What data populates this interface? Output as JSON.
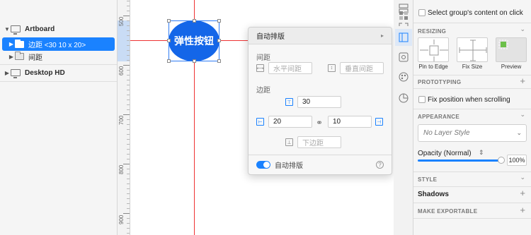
{
  "layers": {
    "artboard": "Artboard",
    "group_selected": "边距 <30 10 x 20>",
    "group_spacing": "间距",
    "desktop": "Desktop HD"
  },
  "ruler": {
    "labels": [
      "500",
      "600",
      "700",
      "800",
      "900"
    ]
  },
  "canvas": {
    "button_label": "弹性按钮"
  },
  "popover": {
    "title": "自动排版",
    "spacing_label": "间距",
    "horizontal_placeholder": "水平间距",
    "vertical_placeholder": "垂直间距",
    "padding_label": "边距",
    "top": "30",
    "left": "20",
    "right": "10",
    "bottom_placeholder": "下边距",
    "toggle_label": "自动排版",
    "help": "?"
  },
  "inspector": {
    "select_group_content": "Select group's content on click",
    "resizing": "RESIZING",
    "pin_to_edge": "Pin to Edge",
    "fix_size": "Fix Size",
    "preview": "Preview",
    "prototyping": "PROTOTYPING",
    "fix_position": "Fix position when scrolling",
    "appearance": "APPEARANCE",
    "layer_style": "No Layer Style",
    "opacity_label": "Opacity (Normal)",
    "opacity_value": "100%",
    "style": "STYLE",
    "shadows": "Shadows",
    "make_exportable": "MAKE EXPORTABLE"
  },
  "colors": {
    "accent": "#1a82ff",
    "button": "#1466e8",
    "guide": "#ee3333"
  }
}
